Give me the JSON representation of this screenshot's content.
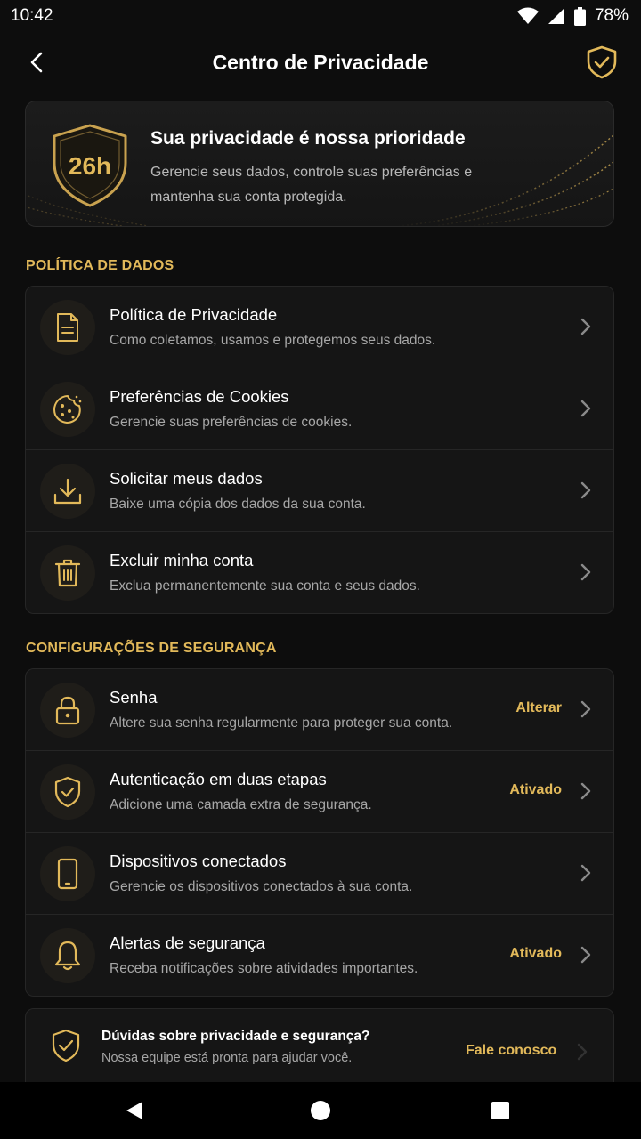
{
  "status_bar": {
    "time": "10:42",
    "battery": "78%"
  },
  "header": {
    "title": "Centro de Privacidade"
  },
  "hero": {
    "badge_text": "26h",
    "title": "Sua privacidade é nossa prioridade",
    "description": "Gerencie seus dados, controle suas preferências e mantenha sua conta protegida."
  },
  "data_policy": {
    "label": "POLÍTICA DE DADOS",
    "items": [
      {
        "title": "Política de Privacidade",
        "subtitle": "Como coletamos, usamos e protegemos seus dados.",
        "icon": "document-icon"
      },
      {
        "title": "Preferências de Cookies",
        "subtitle": "Gerencie suas preferências de cookies.",
        "icon": "cookie-icon"
      },
      {
        "title": "Solicitar meus dados",
        "subtitle": "Baixe uma cópia dos dados da sua conta.",
        "icon": "download-icon"
      },
      {
        "title": "Excluir minha conta",
        "subtitle": "Exclua permanentemente sua conta e seus dados.",
        "icon": "trash-icon"
      }
    ]
  },
  "security": {
    "label": "CONFIGURAÇÕES DE SEGURANÇA",
    "items": [
      {
        "title": "Senha",
        "subtitle": "Altere sua senha regularmente para proteger sua conta.",
        "status": "Alterar",
        "icon": "lock-icon"
      },
      {
        "title": "Autenticação em duas etapas",
        "subtitle": "Adicione uma camada extra de segurança.",
        "status": "Ativado",
        "icon": "shield-check-icon"
      },
      {
        "title": "Dispositivos conectados",
        "subtitle": "Gerencie os dispositivos conectados à sua conta.",
        "status": "",
        "icon": "phone-icon"
      },
      {
        "title": "Alertas de segurança",
        "subtitle": "Receba notificações sobre atividades importantes.",
        "status": "Ativado",
        "icon": "bell-icon"
      }
    ]
  },
  "help": {
    "title": "Dúvidas sobre privacidade e segurança?",
    "subtitle": "Nossa equipe está pronta para ajudar você.",
    "link": "Fale conosco"
  },
  "colors": {
    "accent": "#e2b95a",
    "background": "#0d0d0d",
    "card": "#151515"
  }
}
